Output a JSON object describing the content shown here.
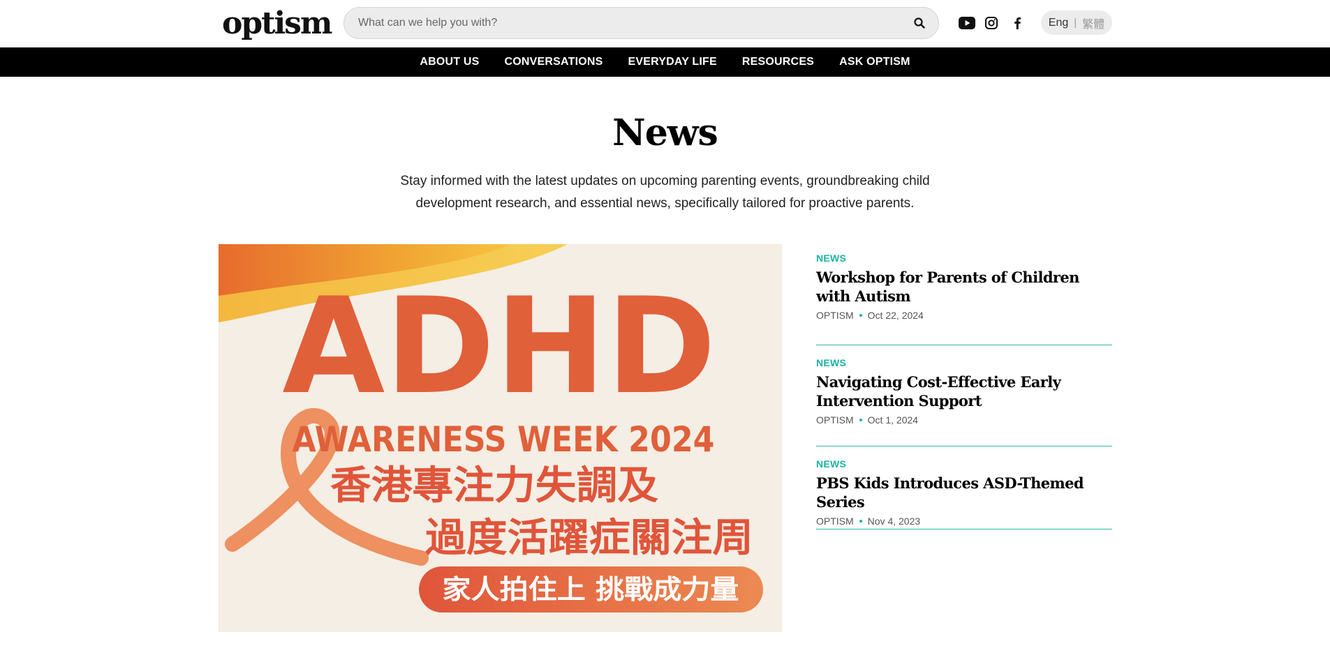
{
  "brand": {
    "logo_text": "optism"
  },
  "search": {
    "placeholder": "What can we help you with?"
  },
  "social": [
    "youtube-icon",
    "instagram-icon",
    "facebook-icon"
  ],
  "language": {
    "english": "Eng",
    "separator": "|",
    "chinese": "繁體"
  },
  "nav": {
    "items": [
      "ABOUT US",
      "CONVERSATIONS",
      "EVERYDAY LIFE",
      "RESOURCES",
      "ASK OPTISM"
    ]
  },
  "page": {
    "title": "News",
    "intro": "Stay informed with the latest updates on upcoming parenting events, groundbreaking child development research, and essential news, specifically tailored for proactive parents."
  },
  "hero": {
    "headline": "ADHD",
    "subheadline": "AWARENESS WEEK 2024",
    "chinese_line1": "香港專注力失調及",
    "chinese_line2": "過度活躍症關注周",
    "banner": "家人拍住上  挑戰成力量"
  },
  "articles": [
    {
      "category": "NEWS",
      "title": "Workshop for Parents of Children with Autism",
      "author": "OPTISM",
      "date": "Oct 22, 2024"
    },
    {
      "category": "NEWS",
      "title": "Navigating Cost-Effective Early Intervention Support",
      "author": "OPTISM",
      "date": "Oct 1, 2024"
    },
    {
      "category": "NEWS",
      "title": "PBS Kids Introduces ASD-Themed Series",
      "author": "OPTISM",
      "date": "Nov 4, 2023"
    }
  ],
  "colors": {
    "accent": "#19b3a3",
    "hero_orange": "#e0603a",
    "nav_bg": "#000000"
  }
}
